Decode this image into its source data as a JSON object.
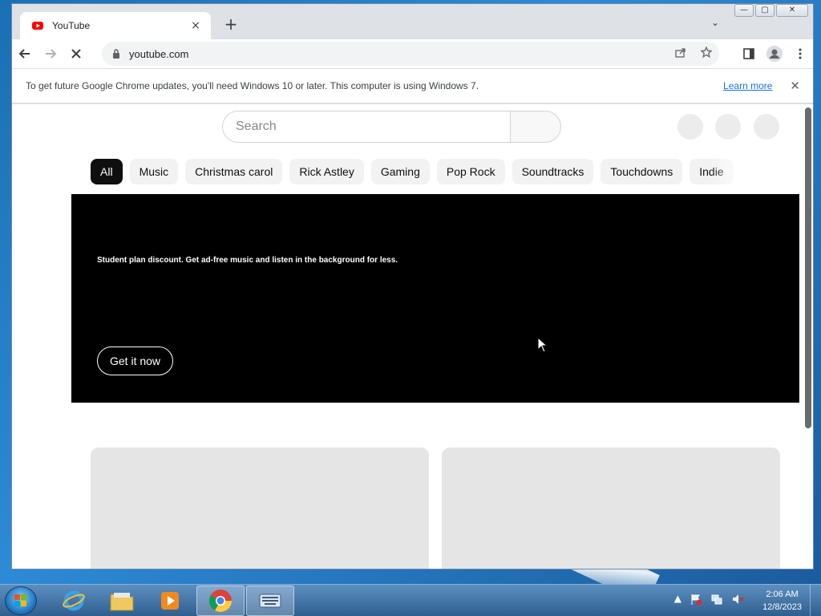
{
  "browser": {
    "tab_title": "YouTube",
    "url": "youtube.com",
    "new_tab_label": "+",
    "tab_close": "×",
    "tab_search": "⌄"
  },
  "window_controls": {
    "minimize": "—",
    "maximize": "▢",
    "close": "✕"
  },
  "infobar": {
    "message": "To get future Google Chrome updates, you'll need Windows 10 or later. This computer is using Windows 7.",
    "link": "Learn more",
    "close": "✕"
  },
  "page": {
    "search_placeholder": "Search",
    "chips": [
      "All",
      "Music",
      "Christmas carol",
      "Rick Astley",
      "Gaming",
      "Pop Rock",
      "Soundtracks",
      "Touchdowns",
      "Indie"
    ],
    "active_chip": "All",
    "banner": {
      "promo_text": "Student plan discount. Get ad-free music and listen in the background for less.",
      "cta": "Get it now"
    }
  },
  "taskbar": {
    "time": "2:06 AM",
    "date": "12/8/2023",
    "tray_arrow": "▲"
  },
  "colors": {
    "youtube_red": "#ff0000",
    "link_blue": "#1a73e8",
    "chip_active": "#0f0f0f"
  }
}
